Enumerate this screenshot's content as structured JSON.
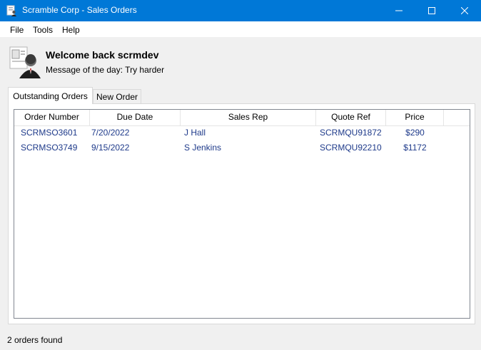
{
  "window": {
    "title": "Scramble Corp - Sales Orders"
  },
  "menu": {
    "items": [
      "File",
      "Tools",
      "Help"
    ]
  },
  "header": {
    "welcome": "Welcome back scrmdev",
    "motd": "Message of the day: Try harder"
  },
  "tabs": [
    {
      "label": "Outstanding Orders",
      "active": true
    },
    {
      "label": "New Order",
      "active": false
    }
  ],
  "orders": {
    "columns": [
      "Order Number",
      "Due Date",
      "Sales Rep",
      "Quote Ref",
      "Price"
    ],
    "rows": [
      [
        "SCRMSO3601",
        "7/20/2022",
        "J Hall",
        "SCRMQU91872",
        "$290"
      ],
      [
        "SCRMSO3749",
        "9/15/2022",
        "S Jenkins",
        "SCRMQU92210",
        "$1172"
      ]
    ]
  },
  "status": {
    "text": "2 orders found"
  },
  "colors": {
    "titlebar": "#0078d7",
    "row_text": "#1e3a8a"
  }
}
